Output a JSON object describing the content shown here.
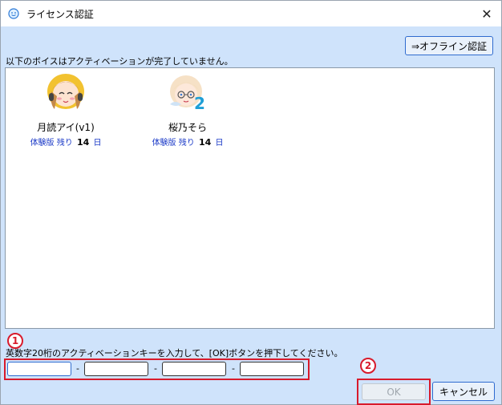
{
  "window": {
    "title": "ライセンス認証",
    "close_glyph": "✕"
  },
  "toolbar": {
    "offline_label": "⇒オフライン認証"
  },
  "notice": "以下のボイスはアクティベーションが完了していません。",
  "voices": [
    {
      "name": "月読アイ(v1)",
      "trial_prefix": "体験版 残り",
      "days": "14",
      "trial_suffix": "日"
    },
    {
      "name": "桜乃そら",
      "trial_prefix": "体験版 残り",
      "days": "14",
      "trial_suffix": "日"
    }
  ],
  "activation": {
    "instruction": "英数字20桁のアクティベーションキーを入力して、[OK]ボタンを押下してください。",
    "separator": "-",
    "keys": [
      "",
      "",
      "",
      ""
    ]
  },
  "badges": {
    "one": "1",
    "two": "2"
  },
  "buttons": {
    "ok_label": "OK",
    "cancel_label": "キャンセル"
  },
  "colors": {
    "accent": "#2f6bcf",
    "highlight": "#d81b2c",
    "trial_text": "#1a39c7"
  }
}
